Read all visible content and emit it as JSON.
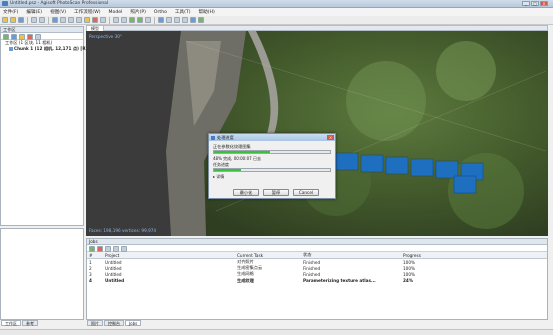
{
  "window": {
    "title": "Untitled.psz - Agisoft PhotoScan Professional"
  },
  "menu": [
    "文件(F)",
    "编辑(E)",
    "视图(V)",
    "工作流程(W)",
    "Model",
    "照片(P)",
    "Ortho",
    "工具(T)",
    "帮助(H)"
  ],
  "workspace": {
    "title": "工作区",
    "rows": [
      {
        "label": "工作区 (1 区块, 11 相机)"
      },
      {
        "label": "Chunk 1 (12 相机, 12,171 点) [R]"
      }
    ],
    "tabs": [
      "工作区",
      "参考"
    ]
  },
  "view": {
    "tab_label": "模型",
    "perspective_label": "Perspective 30°",
    "stats_label": "Faces: 198,196 vertices: 99,974",
    "photo_labels": [
      "IMG_1",
      "IMG_2",
      "IMG_3",
      "IMG_4",
      "IMG_5",
      "IMG_6",
      "IMG_7"
    ]
  },
  "dialog": {
    "title": "处理进度",
    "task_label": "正在参数化纹理图集",
    "progress1": 0.48,
    "status_line": "48% 完成, 00:00:07 已去",
    "sub_label": "任务进度",
    "progress2": 0.23,
    "details_label": "详情",
    "buttons": {
      "minimize": "最小化",
      "pause": "暂停",
      "cancel": "Cancel"
    }
  },
  "jobs": {
    "title": "Jobs",
    "columns": [
      "#",
      "Project",
      "Current Task",
      "状态",
      "Progress"
    ],
    "rows": [
      {
        "id": "1",
        "project": "Untitled",
        "task": "对齐照片",
        "status": "Finished",
        "progress": "100%"
      },
      {
        "id": "2",
        "project": "Untitled",
        "task": "生成密集点云",
        "status": "Finished",
        "progress": "100%"
      },
      {
        "id": "3",
        "project": "Untitled",
        "task": "生成网格",
        "status": "Finished",
        "progress": "100%"
      },
      {
        "id": "4",
        "project": "Untitled",
        "task": "生成纹理",
        "status": "Parameterizing texture atlas...",
        "progress": "24%"
      }
    ],
    "tabs": [
      "照片",
      "控制台",
      "Jobs"
    ]
  },
  "colors": {
    "accent": "#3cbf3c",
    "photo": "#1e6fc0"
  }
}
